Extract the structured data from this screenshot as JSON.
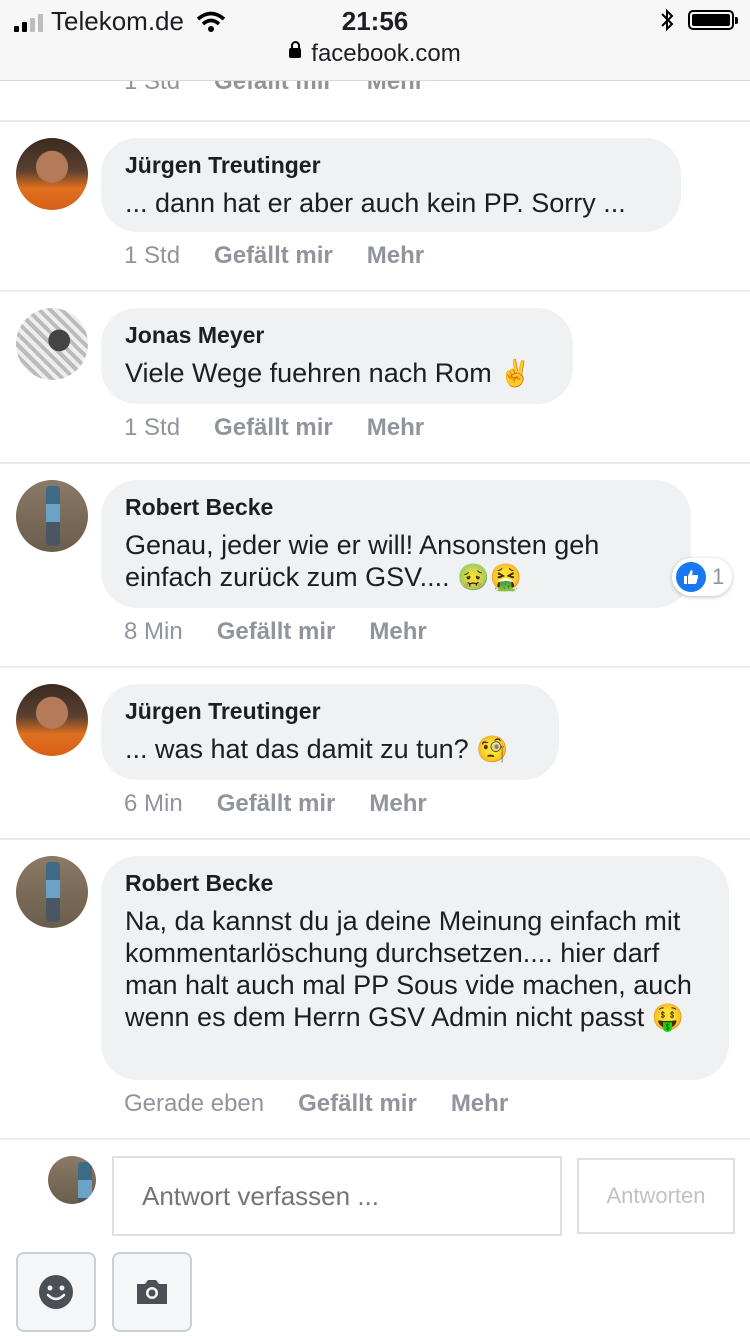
{
  "status_bar": {
    "carrier": "Telekom.de",
    "time": "21:56",
    "url": "facebook.com"
  },
  "partial_comment": {
    "time": "1 Std",
    "like": "Gefällt mir",
    "more": "Mehr"
  },
  "comments": [
    {
      "author": "Jürgen Treutinger",
      "text": "... dann hat er aber auch kein PP. Sorry ...",
      "emoji": "",
      "time": "1 Std",
      "like": "Gefällt mir",
      "more": "Mehr"
    },
    {
      "author": "Jonas Meyer",
      "text": "Viele Wege fuehren nach Rom",
      "emoji": "✌️",
      "time": "1 Std",
      "like": "Gefällt mir",
      "more": "Mehr"
    },
    {
      "author": "Robert Becke",
      "text": "Genau, jeder wie er will! Ansonsten geh einfach zurück zum GSV....",
      "emoji": "🤢🤮",
      "time": "8 Min",
      "like": "Gefällt mir",
      "more": "Mehr",
      "reaction_count": "1"
    },
    {
      "author": "Jürgen Treutinger",
      "text": "... was hat das damit zu tun?",
      "emoji": "🧐",
      "time": "6 Min",
      "like": "Gefällt mir",
      "more": "Mehr"
    },
    {
      "author": "Robert Becke",
      "text": "Na, da kannst du ja deine Meinung einfach mit kommentarlöschung durchsetzen.... hier darf man halt auch mal PP Sous vide machen, auch wenn es dem Herrn GSV Admin nicht passt",
      "emoji": "🤑",
      "time": "Gerade eben",
      "like": "Gefällt mir",
      "more": "Mehr"
    }
  ],
  "reply": {
    "placeholder": "Antwort verfassen ...",
    "button": "Antworten"
  },
  "colors": {
    "bubble": "#f0f1f3",
    "meta_text": "#90949c",
    "like_blue": "#1877f2"
  }
}
